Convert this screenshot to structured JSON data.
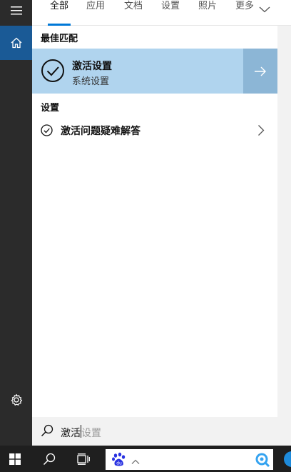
{
  "tabs": [
    {
      "label": "全部"
    },
    {
      "label": "应用"
    },
    {
      "label": "文档"
    },
    {
      "label": "设置"
    },
    {
      "label": "照片"
    },
    {
      "label": "更多"
    }
  ],
  "sections": {
    "best_match_heading": "最佳匹配",
    "settings_heading": "设置"
  },
  "best_match": {
    "title": "激活设置",
    "subtitle": "系统设置"
  },
  "settings_results": [
    {
      "label": "激活问题疑难解答"
    }
  ],
  "search": {
    "typed": "激活",
    "suggestion": "设置"
  },
  "colors": {
    "accent": "#0078d7",
    "selected_bg": "#b0d4ee",
    "arrow_bg": "#8cb6d6",
    "rail_bg": "#2b2b2b",
    "home_bg": "#1a5a96",
    "taskbar_bg": "#1f1f1f"
  },
  "icons": {
    "rail": [
      "hamburger-menu-icon",
      "home-icon",
      "settings-gear-icon"
    ],
    "taskbar": [
      "windows-start-icon",
      "search-icon",
      "task-view-icon",
      "baidu-logo-icon",
      "chevron-up-icon",
      "baidu-search-icon",
      "edge-icon"
    ]
  }
}
